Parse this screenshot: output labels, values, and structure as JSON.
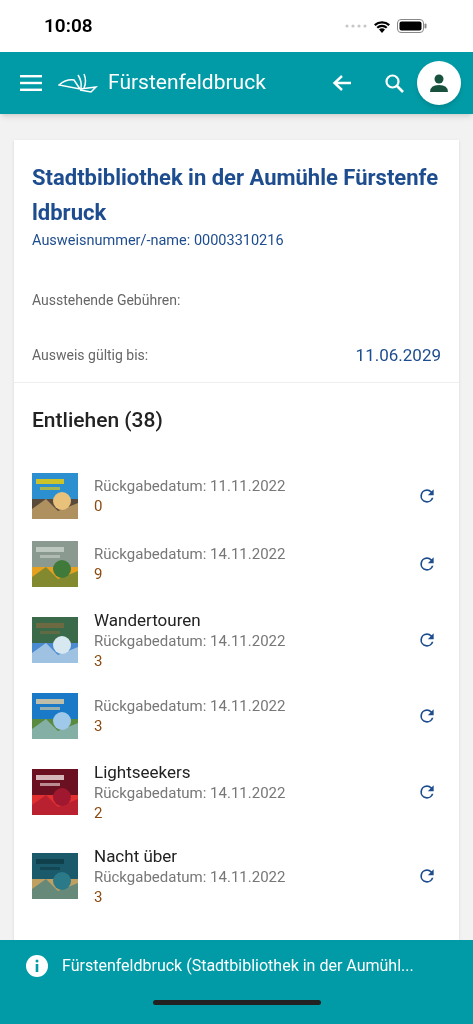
{
  "status_bar": {
    "time": "10:08"
  },
  "app_bar": {
    "title": "Fürstenfeldbruck"
  },
  "account": {
    "library": "Stadtbibliothek in der Aumühle Fürstenfeldbruck",
    "card_number": "Ausweisnummer/-name: 00003310216",
    "fees_label": "Ausstehende Gebühren:",
    "valid_label": "Ausweis gültig bis:",
    "valid_value": "11.06.2029"
  },
  "loans": {
    "heading": "Entliehen (38)",
    "items": [
      {
        "due": "Rückgabedatum: 11.11.2022",
        "count": "0"
      },
      {
        "due": "Rückgabedatum: 14.11.2022",
        "count": "9"
      },
      {
        "title": "Wandertouren",
        "due": "Rückgabedatum: 14.11.2022",
        "count": "3"
      },
      {
        "due": "Rückgabedatum: 14.11.2022",
        "count": "3"
      },
      {
        "title": "Lightseekers",
        "due": "Rückgabedatum: 14.11.2022",
        "count": "2"
      },
      {
        "title": "Nacht über",
        "due": "Rückgabedatum: 14.11.2022",
        "count": "3"
      }
    ]
  },
  "snackbar": {
    "text": "Fürstenfeldbruck (Stadtbibliothek in der Aumühl..."
  }
}
